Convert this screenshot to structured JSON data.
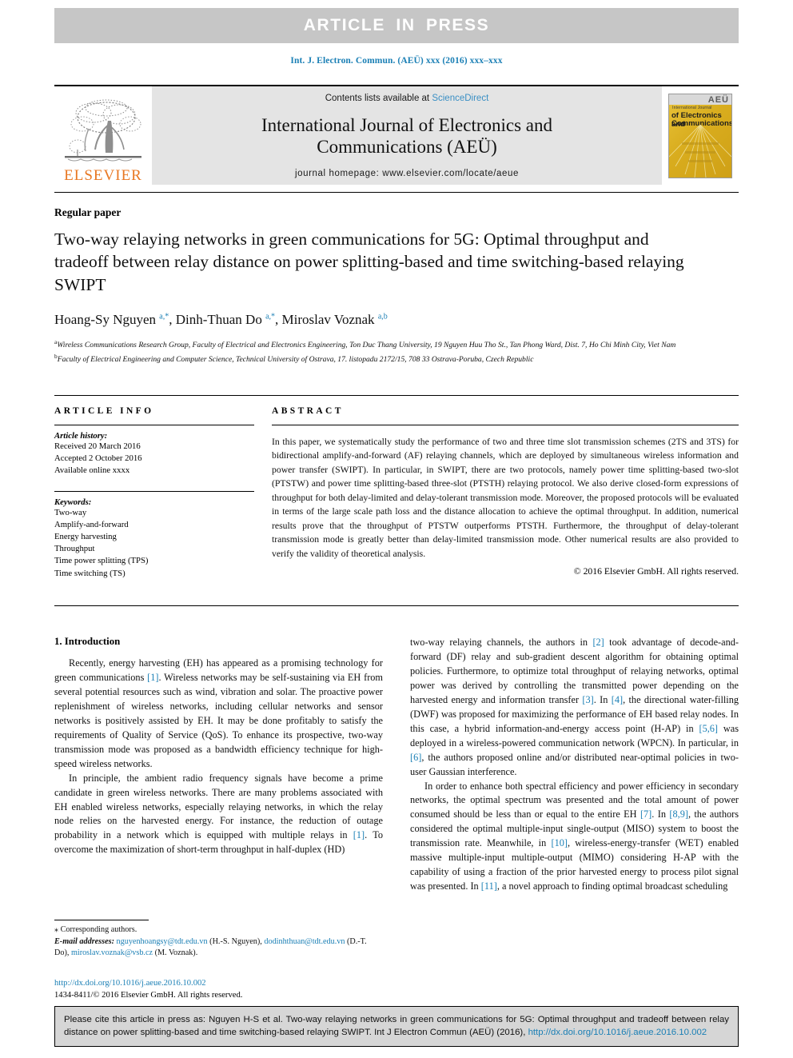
{
  "banner": {
    "text": "ARTICLE  IN  PRESS"
  },
  "running_head": "Int. J. Electron. Commun. (AEÜ) xxx (2016) xxx–xxx",
  "masthead": {
    "contents_prefix": "Contents lists available at ",
    "sciencedirect": "ScienceDirect",
    "journal_title_line1": "International Journal of Electronics and",
    "journal_title_line2": "Communications (AEÜ)",
    "homepage": "journal homepage: www.elsevier.com/locate/aeue",
    "publisher": "ELSEVIER",
    "cover": {
      "aeu": "AEÜ",
      "international_journal": "International Journal",
      "line1": "of Electronics and",
      "line2": "Communications"
    }
  },
  "article": {
    "type": "Regular paper",
    "title": "Two-way relaying networks in green communications for 5G: Optimal throughput and tradeoff between relay distance on power splitting-based and time switching-based relaying SWIPT",
    "authors_html": "Hoang-Sy Nguyen <sup>a,*</sup>, Dinh-Thuan Do <sup>a,*</sup>, Miroslav Voznak <sup>a,b</sup>",
    "affiliation_a": "Wireless Communications Research Group, Faculty of Electrical and Electronics Engineering, Ton Duc Thang University, 19 Nguyen Huu Tho St., Tan Phong Ward, Dist. 7, Ho Chi Minh City, Viet Nam",
    "affiliation_b": "Faculty of Electrical Engineering and Computer Science, Technical University of Ostrava, 17. listopadu 2172/15, 708 33 Ostrava-Poruba, Czech Republic"
  },
  "info": {
    "heading": "ARTICLE INFO",
    "history_label": "Article history:",
    "history": [
      "Received 20 March 2016",
      "Accepted 2 October 2016",
      "Available online xxxx"
    ],
    "keywords_label": "Keywords:",
    "keywords": [
      "Two-way",
      "Amplify-and-forward",
      "Energy harvesting",
      "Throughput",
      "Time power splitting (TPS)",
      "Time switching (TS)"
    ]
  },
  "abstract": {
    "heading": "ABSTRACT",
    "text": "In this paper, we systematically study the performance of two and three time slot transmission schemes (2TS and 3TS) for bidirectional amplify-and-forward (AF) relaying channels, which are deployed by simultaneous wireless information and power transfer (SWIPT). In particular, in SWIPT, there are two protocols, namely power time splitting-based two-slot (PTSTW) and power time splitting-based three-slot (PTSTH) relaying protocol. We also derive closed-form expressions of throughput for both delay-limited and delay-tolerant transmission mode. Moreover, the proposed protocols will be evaluated in terms of the large scale path loss and the distance allocation to achieve the optimal throughput. In addition, numerical results prove that the throughput of PTSTW outperforms PTSTH. Furthermore, the throughput of delay-tolerant transmission mode is greatly better than delay-limited transmission mode. Other numerical results are also provided to verify the validity of theoretical analysis.",
    "copyright": "© 2016 Elsevier GmbH. All rights reserved."
  },
  "body": {
    "section_title": "1. Introduction",
    "left_para_1_html": "Recently, energy harvesting (EH) has appeared as a promising technology for green communications <span class=\"ref\">[1]</span>. Wireless networks may be self-sustaining via EH from several potential resources such as wind, vibration and solar. The proactive power replenishment of wireless networks, including cellular networks and sensor networks is positively assisted by EH. It may be done profitably to satisfy the requirements of Quality of Service (QoS). To enhance its prospective, two-way transmission mode was proposed as a bandwidth efficiency technique for high-speed wireless networks.",
    "left_para_2_html": "In principle, the ambient radio frequency signals have become a prime candidate in green wireless networks. There are many problems associated with EH enabled wireless networks, especially relaying networks, in which the relay node relies on the harvested energy. For instance, the reduction of outage probability in a network which is equipped with multiple relays in <span class=\"ref\">[1]</span>. To overcome the maximization of short-term throughput in half-duplex (HD)",
    "right_para_1_html": "two-way relaying channels, the authors in <span class=\"ref\">[2]</span> took advantage of decode-and-forward (DF) relay and sub-gradient descent algorithm for obtaining optimal policies. Furthermore, to optimize total throughput of relaying networks, optimal power was derived by controlling the transmitted power depending on the harvested energy and information transfer <span class=\"ref\">[3]</span>. In <span class=\"ref\">[4]</span>, the directional water-filling (DWF) was proposed for maximizing the performance of EH based relay nodes. In this case, a hybrid information-and-energy access point (H-AP) in <span class=\"ref\">[5,6]</span> was deployed in a wireless-powered communication network (WPCN). In particular, in <span class=\"ref\">[6]</span>, the authors proposed online and/or distributed near-optimal policies in two-user Gaussian interference.",
    "right_para_2_html": "In order to enhance both spectral efficiency and power efficiency in secondary networks, the optimal spectrum was presented and the total amount of power consumed should be less than or equal to the entire EH <span class=\"ref\">[7]</span>. In <span class=\"ref\">[8,9]</span>, the authors considered the optimal multiple-input single-output (MISO) system to boost the transmission rate. Meanwhile, in <span class=\"ref\">[10]</span>, wireless-energy-transfer (WET) enabled massive multiple-input multiple-output (MIMO) considering H-AP with the capability of using a fraction of the prior harvested energy to process pilot signal was presented. In <span class=\"ref\">[11]</span>, a novel approach to finding optimal broadcast scheduling"
  },
  "footnotes": {
    "corresponding": "⁎ Corresponding authors.",
    "emails_html": "<span class=\"fn-em\">E-mail addresses:</span> <span class=\"lnk\">nguyenhoangsy@tdt.edu.vn</span> (H.-S. Nguyen), <span class=\"lnk\">dodinhthuan@tdt.edu.vn</span> (D.-T. Do), <span class=\"lnk\">miroslav.voznak@vsb.cz</span> (M. Voznak).",
    "doi": "http://dx.doi.org/10.1016/j.aeue.2016.10.002",
    "issn": "1434-8411/© 2016 Elsevier GmbH. All rights reserved."
  },
  "cite_box": {
    "text_html": "Please cite this article in press as: Nguyen H-S et al. Two-way relaying networks in green communications for 5G: Optimal throughput and tradeoff between relay distance on power splitting-based and time switching-based relaying SWIPT. Int J Electron Commun (AEÜ) (2016), <span class=\"lnk\">http://dx.doi.org/10.1016/j.aeue.2016.10.002</span>"
  },
  "colors": {
    "link": "#1a7fb5",
    "banner_bg": "#c6c6c6",
    "band_bg": "#e4e4e4",
    "elsevier_orange": "#E87722",
    "cite_bg": "#d6d6d6"
  }
}
